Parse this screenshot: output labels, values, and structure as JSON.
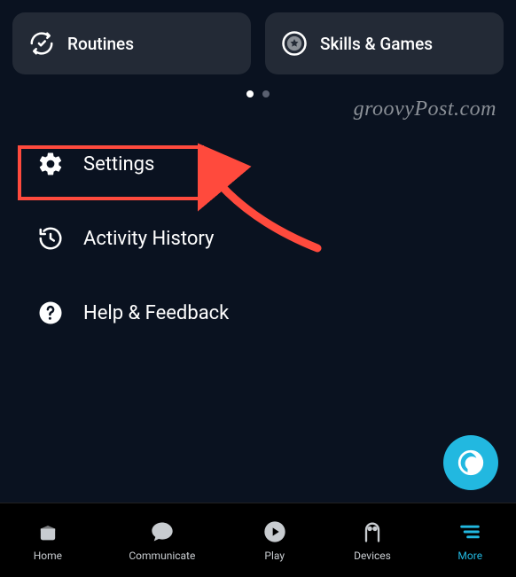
{
  "cards": {
    "routines": "Routines",
    "skills": "Skills & Games"
  },
  "watermark": "groovyPost.com",
  "menu": {
    "settings": "Settings",
    "activity": "Activity History",
    "help": "Help & Feedback"
  },
  "nav": {
    "home": "Home",
    "communicate": "Communicate",
    "play": "Play",
    "devices": "Devices",
    "more": "More"
  },
  "annotation": {
    "highlight_target": "settings",
    "arrow_color": "#ff4a3d"
  }
}
